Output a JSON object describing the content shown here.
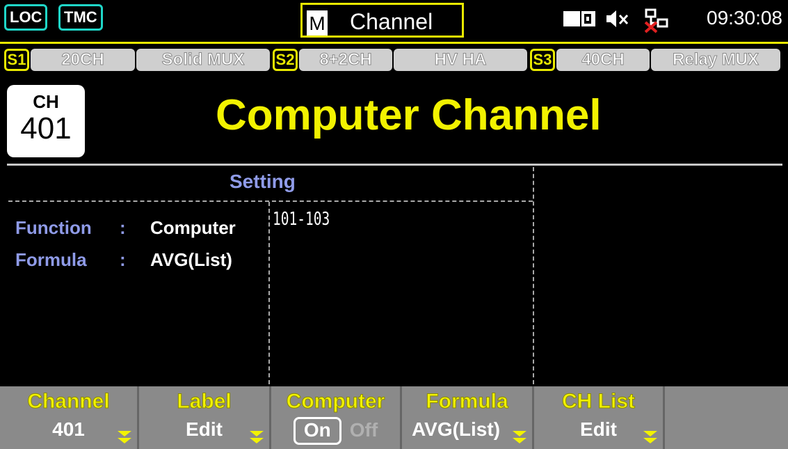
{
  "status": {
    "loc": "LOC",
    "tmc": "TMC",
    "mode_letter": "M",
    "title": "Channel",
    "time": "09:30:08",
    "icons": [
      "card-icon",
      "mute-icon",
      "network-disconnected-icon"
    ]
  },
  "slots": [
    {
      "id": "S1",
      "channels": "20CH",
      "type": "Solid MUX"
    },
    {
      "id": "S2",
      "channels": "8+2CH",
      "type": "HV HA"
    },
    {
      "id": "S3",
      "channels": "40CH",
      "type": "Relay MUX"
    }
  ],
  "channel_badge": {
    "label": "CH",
    "number": "401"
  },
  "page_title": "Computer Channel",
  "setting": {
    "header": "Setting",
    "rows": [
      {
        "label": "Function",
        "colon": ":",
        "value": "Computer"
      },
      {
        "label": "Formula",
        "colon": ":",
        "value": "AVG(List)"
      }
    ],
    "list_value": "101-103"
  },
  "softkeys": [
    {
      "title": "Channel",
      "value": "401"
    },
    {
      "title": "Label",
      "value": "Edit"
    },
    {
      "title": "Computer",
      "on": "On",
      "off": "Off"
    },
    {
      "title": "Formula",
      "value": "AVG(List)"
    },
    {
      "title": "CH List",
      "value": "Edit"
    },
    {
      "title": "",
      "value": ""
    }
  ],
  "colors": {
    "accent": "#f2f200",
    "label": "#8f9be8",
    "mode_border": "#1fd6c8"
  }
}
